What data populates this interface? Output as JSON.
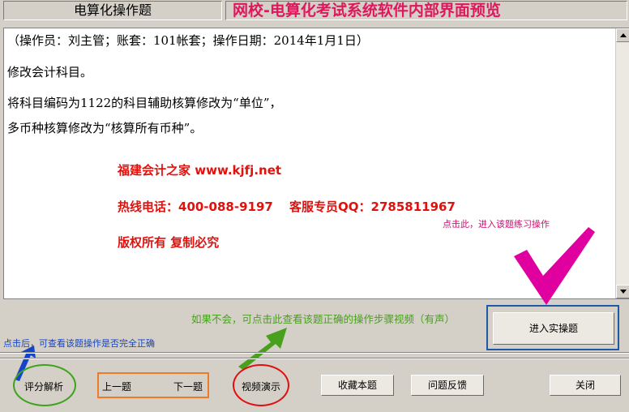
{
  "header": {
    "window_title": "电算化操作题",
    "preview_title": "网校-电算化考试系统软件内部界面预览"
  },
  "question": {
    "meta": "（操作员：刘主管；账套：101帐套；操作日期：2014年1月1日）",
    "line1": "修改会计科目。",
    "line2": "将科目编码为1122的科目辅助核算修改为“单位”，",
    "line3": "多币种核算修改为“核算所有币种”。"
  },
  "promo": {
    "site": "福建会计之家 www.kjfj.net",
    "hotline": "热线电话：400-088-9197　 客服专员QQ：2785811967",
    "copyright": "版权所有 复制必究"
  },
  "hints": {
    "practice": "点击此，进入该题练习操作",
    "video": "如果不会，可点击此查看该题正确的操作步骤视频（有声）",
    "grade": "点击后，可查看该题操作是否完全正确"
  },
  "buttons": {
    "practice": "进入实操题",
    "grade": "评分解析",
    "prev": "上一题",
    "next": "下一题",
    "video": "视频演示",
    "favorite": "收藏本题",
    "feedback": "问题反馈",
    "close": "关闭"
  },
  "colors": {
    "title_pink": "#e0175d",
    "promo_red": "#e0120e",
    "hint_green": "#48a01c",
    "hint_blue": "#1445c8",
    "hint_magenta": "#c8106c"
  }
}
